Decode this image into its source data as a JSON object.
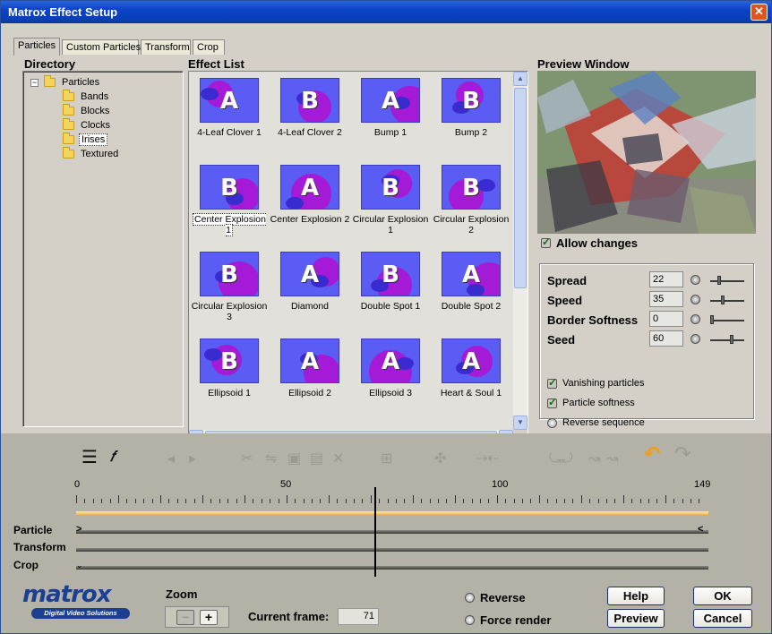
{
  "window": {
    "title": "Matrox Effect Setup",
    "close_glyph": "✕"
  },
  "tabs": [
    {
      "label": "Particles",
      "active": true
    },
    {
      "label": "Custom Particles",
      "active": false
    },
    {
      "label": "Transform",
      "active": false
    },
    {
      "label": "Crop",
      "active": false
    }
  ],
  "directory": {
    "header": "Directory",
    "root": {
      "label": "Particles",
      "expander": "−"
    },
    "items": [
      "Bands",
      "Blocks",
      "Clocks",
      "Irises",
      "Textured"
    ],
    "selected": "Irises"
  },
  "effect_list": {
    "header": "Effect List",
    "items": [
      {
        "label": "4-Leaf Clover 1",
        "glyph": "A"
      },
      {
        "label": "4-Leaf Clover 2",
        "glyph": "B"
      },
      {
        "label": "Bump 1",
        "glyph": "A"
      },
      {
        "label": "Bump 2",
        "glyph": "B"
      },
      {
        "label": "Center Explosion 1",
        "glyph": "B"
      },
      {
        "label": "Center Explosion 2",
        "glyph": "A"
      },
      {
        "label": "Circular Explosion 1",
        "glyph": "B"
      },
      {
        "label": "Circular Explosion 2",
        "glyph": "B"
      },
      {
        "label": "Circular Explosion 3",
        "glyph": "B"
      },
      {
        "label": "Diamond",
        "glyph": "A"
      },
      {
        "label": "Double Spot 1",
        "glyph": "B"
      },
      {
        "label": "Double Spot 2",
        "glyph": "A"
      },
      {
        "label": "Ellipsoid 1",
        "glyph": "B"
      },
      {
        "label": "Ellipsoid 2",
        "glyph": "A"
      },
      {
        "label": "Ellipsoid 3",
        "glyph": "A"
      },
      {
        "label": "Heart & Soul 1",
        "glyph": "A"
      }
    ],
    "selected": "Center Explosion 1",
    "scroll": {
      "up": "▲",
      "down": "▼",
      "left": "◀",
      "right": "▶"
    }
  },
  "preview": {
    "header": "Preview Window",
    "allow_changes": {
      "label": "Allow changes",
      "checked": true
    }
  },
  "parameters": [
    {
      "label": "Spread",
      "value": "22",
      "slider": 0.22
    },
    {
      "label": "Speed",
      "value": "35",
      "slider": 0.35
    },
    {
      "label": "Border Softness",
      "value": "0",
      "slider": 0.0
    },
    {
      "label": "Seed",
      "value": "60",
      "slider": 0.6
    }
  ],
  "options": {
    "vanishing": {
      "label": "Vanishing particles",
      "checked": true
    },
    "softness": {
      "label": "Particle softness",
      "checked": true
    },
    "reverse_sequence": {
      "label": "Reverse sequence",
      "selected": false
    }
  },
  "timeline": {
    "ruler_labels": [
      "0",
      "50",
      "100",
      "149"
    ],
    "tracks": [
      "Particle",
      "Transform",
      "Crop"
    ],
    "markers": {
      "start": ">",
      "end": "<"
    },
    "toolbar_icons": [
      "keyframe-list-icon",
      "keyframe-toggle-icon",
      "previous-keyframe-icon",
      "next-keyframe-icon",
      "cut-icon",
      "copy-icon",
      "paste-icon",
      "paste-special-icon",
      "delete-icon",
      "fit-timeline-icon",
      "add-keyframe-icon",
      "mirror-icon",
      "flip-icon",
      "ease-in-icon",
      "ease-out-icon",
      "undo-icon",
      "redo-icon"
    ]
  },
  "logo": {
    "word": "matrox",
    "tagline": "Digital Video Solutions"
  },
  "zoom": {
    "label": "Zoom",
    "minus": "−",
    "plus": "+"
  },
  "current_frame": {
    "label": "Current frame:",
    "value": "71"
  },
  "playback": {
    "reverse": {
      "label": "Reverse",
      "selected": false
    },
    "force_render": {
      "label": "Force render",
      "selected": false
    }
  },
  "buttons": {
    "help": "Help",
    "ok": "OK",
    "preview": "Preview",
    "cancel": "Cancel"
  },
  "colors": {
    "titlebar": "#0a43c6",
    "thumb_bg": "#5b5cf3",
    "thumb_accent": "#a41ad6",
    "timeline_bar": "#e7a538",
    "logo": "#1a3f93"
  }
}
